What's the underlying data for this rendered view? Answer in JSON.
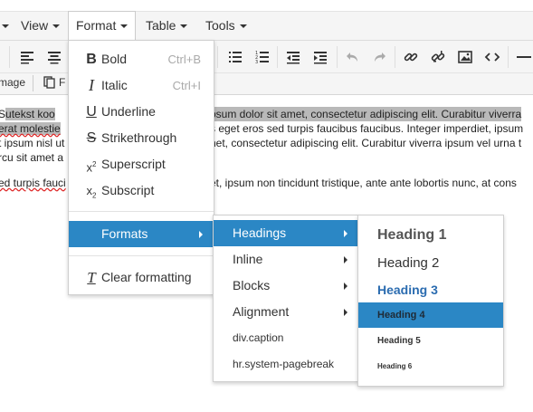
{
  "menubar": {
    "view": "View",
    "format": "Format",
    "table": "Table",
    "tools": "Tools"
  },
  "toolbar2": {
    "image_label": "mage",
    "partial_label": "F"
  },
  "content": {
    "line1_a": "S",
    "line1_b": "utekst koo",
    "line1_c": "psum dolor sit amet, consectetur adipiscing elit. Curabitur viverra",
    "line2_a": "erat molestie",
    "line2_b": "s eget eros sed turpis faucibus faucibus. Integer imperdiet, ipsum",
    "line3_a": "t ipsum nisl ut",
    "line3_b": "net, consectetur adipiscing elit. Curabitur viverra ipsum vel urna t",
    "line4": "rcu sit amet a",
    "line5_a": "ed turpis fauci",
    "line5_b": "et, ipsum non tincidunt tristique, ante ante lobortis nunc, at cons"
  },
  "format_menu": {
    "bold": "Bold",
    "bold_shortcut": "Ctrl+B",
    "italic": "Italic",
    "italic_shortcut": "Ctrl+I",
    "underline": "Underline",
    "strikethrough": "Strikethrough",
    "superscript": "Superscript",
    "subscript": "Subscript",
    "formats": "Formats",
    "clear_formatting": "Clear formatting"
  },
  "formats_menu": {
    "headings": "Headings",
    "inline": "Inline",
    "blocks": "Blocks",
    "alignment": "Alignment",
    "div_caption": "div.caption",
    "hr_pagebreak": "hr.system-pagebreak"
  },
  "headings_menu": {
    "h1": "Heading 1",
    "h2": "Heading 2",
    "h3": "Heading 3",
    "h4": "Heading 4",
    "h5": "Heading 5",
    "h6": "Heading 6"
  },
  "colors": {
    "selected": "#2b87c5",
    "heading3": "#2b6cb0",
    "text_selection": "#b9b9b9"
  }
}
